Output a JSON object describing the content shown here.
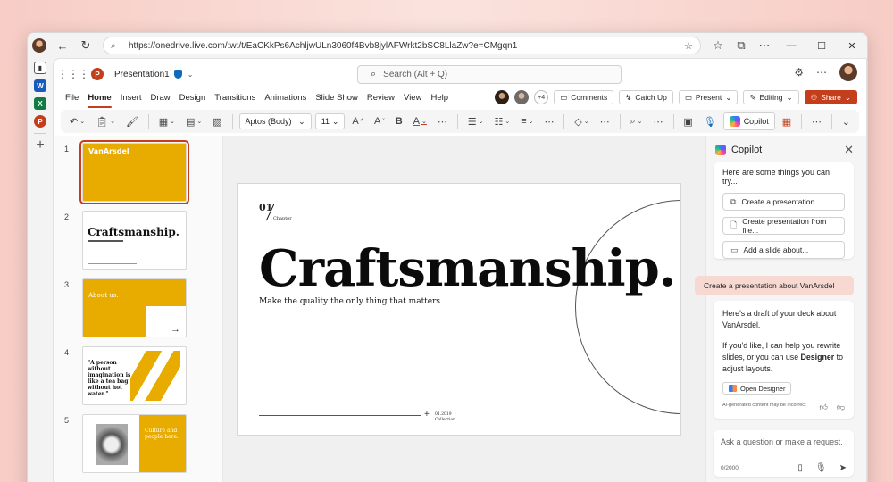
{
  "browser": {
    "url": "https://onedrive.live.com/:w:/t/EaCKkPs6AchljwULn3060f4Bvb8jylAFWrkt2bSC8LlaZw?e=CMgqn1"
  },
  "app": {
    "doc_name": "Presentation1",
    "search_placeholder": "Search (Alt + Q)",
    "ppt_logo": "P"
  },
  "tabs": [
    "File",
    "Home",
    "Insert",
    "Draw",
    "Design",
    "Transitions",
    "Animations",
    "Slide Show",
    "Review",
    "View",
    "Help"
  ],
  "active_tab": "Home",
  "collab": {
    "extra_count": "+4",
    "comments": "Comments",
    "catch_up": "Catch Up",
    "present": "Present",
    "editing": "Editing",
    "share": "Share"
  },
  "ribbon": {
    "font_name": "Aptos (Body)",
    "font_size": "11",
    "copilot_label": "Copilot"
  },
  "thumbnails": {
    "numbers": [
      "1",
      "2",
      "3",
      "4",
      "5"
    ],
    "t1_brand": "VanArsdel",
    "t2_title": "Craftsmanship.",
    "t3_title": "About us.",
    "t4_quote": "\"A person without imagination is like a tea bag without hot water.\"",
    "t5_title": "Culture and people here."
  },
  "slide": {
    "number": "01",
    "chapter": "Chapter",
    "title": "Craftsmanship.",
    "subtitle": "Make the quality the only thing that matters",
    "year": "01.2019",
    "collection": "Collection"
  },
  "copilot": {
    "title": "Copilot",
    "try_lead": "Here are some things you can try...",
    "suggestions": [
      "Create a presentation...",
      "Create presentation from file...",
      "Add a slide about..."
    ],
    "user_message": "Create a presentation about VanArsdel",
    "resp_p1": "Here's a draft of your deck about VanArsdel.",
    "resp_p2_a": "If you'd like, I can help you rewrite slides, or you can use ",
    "resp_p2_b": "Designer",
    "resp_p2_c": " to adjust layouts.",
    "open_designer": "Open Designer",
    "disclaimer": "AI-generated content may be incorrect",
    "ask_placeholder": "Ask a question or make a request.",
    "char_count": "0/2000"
  },
  "colors": {
    "accent": "#c43e1c",
    "gold": "#e8ab00",
    "user_bubble": "#f7d9d2"
  }
}
